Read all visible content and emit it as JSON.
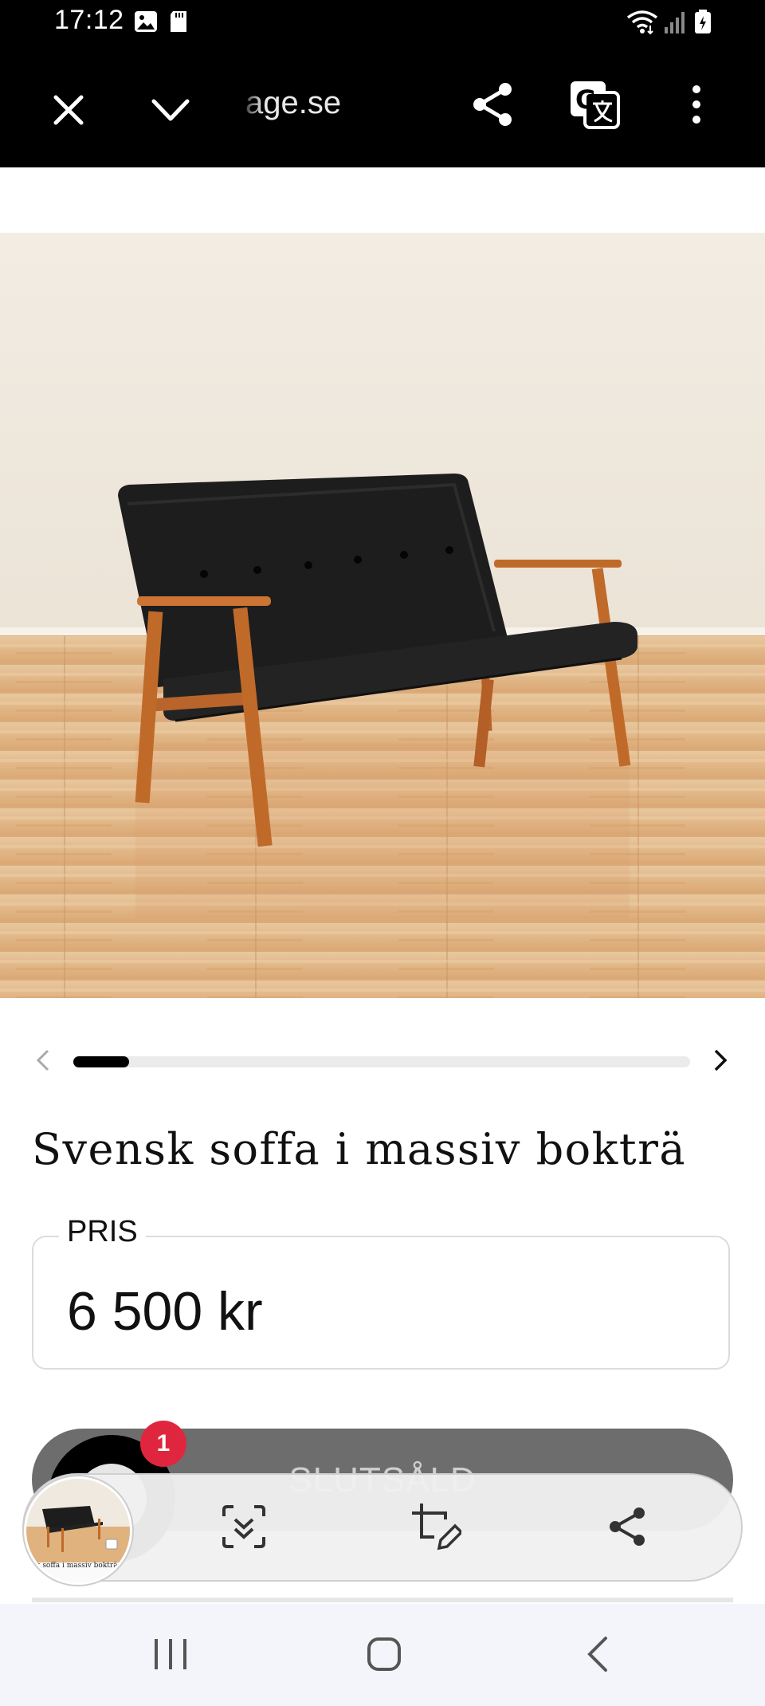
{
  "status_bar": {
    "time": "17:12",
    "icons": [
      "image-icon",
      "sd-card-icon",
      "wifi-icon",
      "signal-icon",
      "battery-icon"
    ]
  },
  "browser": {
    "url": "age.se",
    "icons": [
      "close-icon",
      "chevron-down-icon",
      "share-icon",
      "translate-icon",
      "more-vert-icon"
    ]
  },
  "carousel": {
    "progress": 0.09,
    "icons": [
      "chevron-left-icon",
      "chevron-right-icon"
    ]
  },
  "product": {
    "title": "Svensk soffa i massiv bokträ",
    "price_label": "PRIS",
    "price": "6 500 kr",
    "sold_label": "SLUTSÅLD"
  },
  "notification_badge": "1",
  "screenshot_toolbar": {
    "thumb_caption": "k soffa i massiv bokträ",
    "icons": [
      "scroll-capture-icon",
      "crop-edit-icon",
      "share-icon"
    ]
  },
  "nav_bar": {
    "icons": [
      "recents-icon",
      "home-icon",
      "back-icon"
    ]
  },
  "colors": {
    "badge": "#e0263e",
    "sold_button": "#6d6d6d",
    "wood": "#c06a2a",
    "leather": "#1d1d1d"
  }
}
